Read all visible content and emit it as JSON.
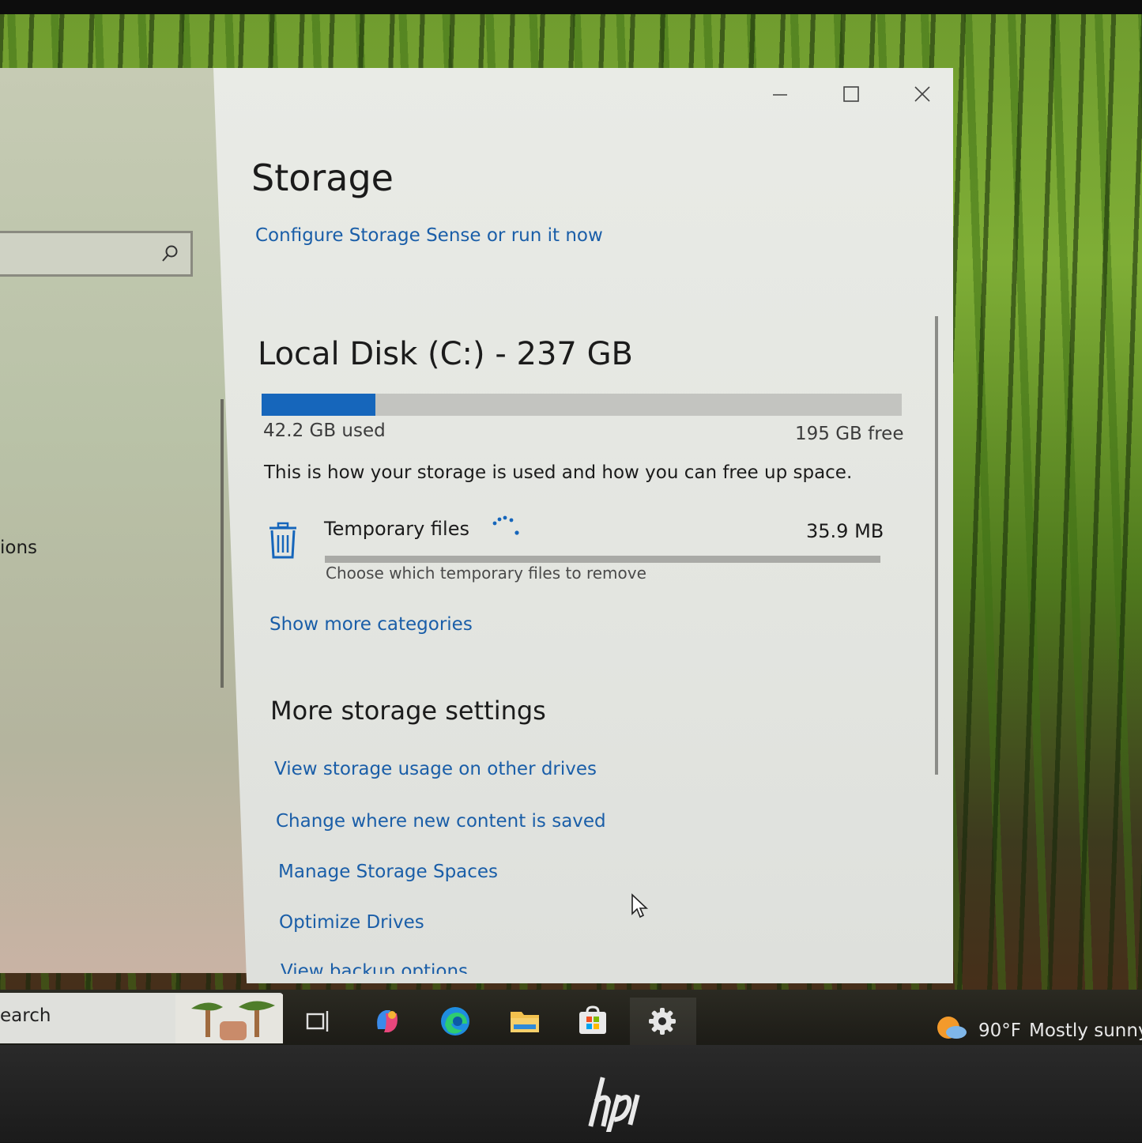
{
  "window": {
    "title": "Storage",
    "controls": {
      "minimize_icon": "minimize-icon",
      "maximize_icon": "maximize-icon",
      "close_icon": "close-icon"
    }
  },
  "nav": {
    "search_icon": "search-icon",
    "item_partial_text": "ions"
  },
  "storage": {
    "storage_sense_link": "Configure Storage Sense or run it now",
    "disk_title": "Local Disk (C:) - 237 GB",
    "used": "42.2 GB used",
    "free": "195 GB free",
    "used_fraction": 0.178,
    "description": "This is how your storage is used and how you can free up space.",
    "categories": [
      {
        "label": "Temporary files",
        "size": "35.9 MB",
        "subtitle": "Choose which temporary files to remove",
        "icon": "trash-icon",
        "loading": true
      }
    ],
    "show_more_link": "Show more categories"
  },
  "more_settings": {
    "title": "More storage settings",
    "links": [
      "View storage usage on other drives",
      "Change where new content is saved",
      "Manage Storage Spaces",
      "Optimize Drives",
      "View backup options"
    ]
  },
  "taskbar": {
    "search_text": "earch",
    "icons": [
      "task-view-icon",
      "copilot-icon",
      "edge-icon",
      "file-explorer-icon",
      "store-icon",
      "settings-icon"
    ],
    "active": "settings-icon",
    "weather": {
      "temp": "90°F",
      "desc": "Mostly sunny"
    }
  },
  "colors": {
    "accent": "#1666bb",
    "link": "#1a5ea8",
    "window_bg": "#e6e8e3",
    "taskbar_bg": "#1f1e18"
  }
}
